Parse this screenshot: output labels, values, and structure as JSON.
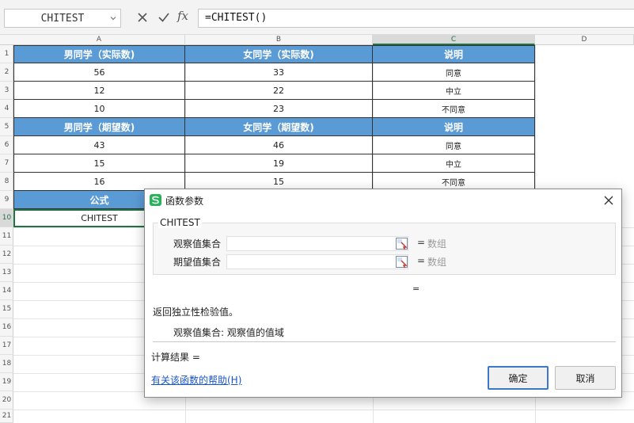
{
  "formula_bar": {
    "name_box": "CHITEST",
    "formula": "=CHITEST()",
    "fx_label": "fx"
  },
  "columns": [
    "A",
    "B",
    "C",
    "D"
  ],
  "rows": [
    "1",
    "2",
    "3",
    "4",
    "5",
    "6",
    "7",
    "8",
    "9",
    "10",
    "11",
    "12",
    "13",
    "14",
    "15",
    "16",
    "17",
    "18",
    "19",
    "20",
    "21"
  ],
  "table": {
    "header1": [
      "男同学（实际数)",
      "女同学（实际数)",
      "说明"
    ],
    "data1": [
      [
        "56",
        "33",
        "同意"
      ],
      [
        "12",
        "22",
        "中立"
      ],
      [
        "10",
        "23",
        "不同意"
      ]
    ],
    "header2": [
      "男同学（期望数)",
      "女同学（期望数)",
      "说明"
    ],
    "data2": [
      [
        "43",
        "46",
        "同意"
      ],
      [
        "15",
        "19",
        "中立"
      ],
      [
        "16",
        "15",
        "不同意"
      ]
    ],
    "formula_header": "公式",
    "formula_cell": "CHITEST"
  },
  "dialog": {
    "title": "函数参数",
    "function_name": "CHITEST",
    "args": [
      {
        "label": "观察值集合",
        "value": "",
        "eq": "=",
        "type": "数组"
      },
      {
        "label": "期望值集合",
        "value": "",
        "eq": "=",
        "type": "数组"
      }
    ],
    "result_eq": "=",
    "description": "返回独立性检验值。",
    "arg_description": "观察值集合:  观察值的值域",
    "calc_result": "计算结果  =",
    "help_link": "有关该函数的帮助(H)",
    "ok": "确定",
    "cancel": "取消"
  },
  "colors": {
    "header_fill": "#5b9bd5",
    "selection": "#217346",
    "dialog_icon": "#28b35a"
  }
}
